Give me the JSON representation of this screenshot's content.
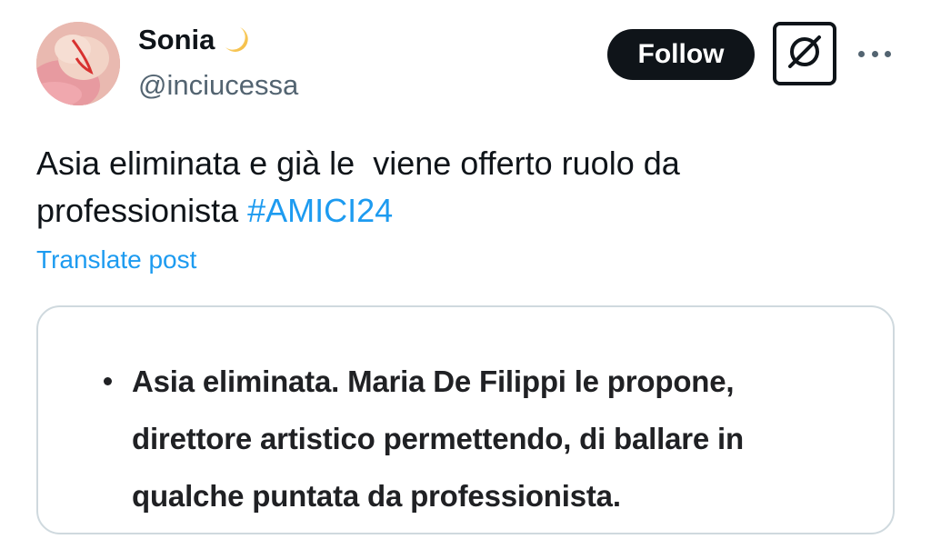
{
  "post": {
    "author": {
      "display_name": "Sonia",
      "emoji": "🌙",
      "handle": "@inciucessa"
    },
    "follow_label": "Follow",
    "text_before": "Asia eliminata e già le  viene offerto ruolo da professionista ",
    "hashtag": "#AMICI24",
    "translate_label": "Translate post",
    "image_card": {
      "bullet_text": "Asia eliminata. Maria De Filippi le propone, direttore artistico permettendo, di ballare in qualche puntata da professionista."
    }
  },
  "icons": {
    "grok": "grok-icon",
    "more": "more-options-icon",
    "moon": "crescent-moon-icon"
  },
  "colors": {
    "link": "#1d9bf0",
    "follow_bg": "#0f1419",
    "secondary_text": "#536471",
    "card_border": "#cfd9de"
  }
}
